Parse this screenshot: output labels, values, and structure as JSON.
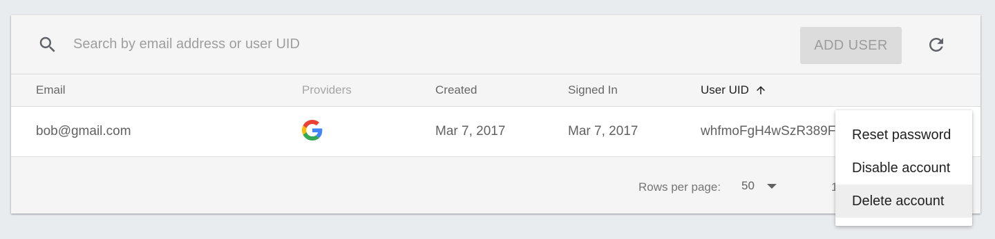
{
  "toolbar": {
    "search_placeholder": "Search by email address or user UID",
    "search_value": "",
    "add_user_label": "ADD USER"
  },
  "table": {
    "columns": [
      "Email",
      "Providers",
      "Created",
      "Signed In",
      "User UID"
    ],
    "sorted_column": "User UID",
    "sort_direction": "ascending",
    "rows": [
      {
        "email": "bob@gmail.com",
        "provider_icon": "google-icon",
        "created": "Mar 7, 2017",
        "signed_in": "Mar 7, 2017",
        "uid": "whfmoFgH4wSzR389F"
      }
    ]
  },
  "pagination": {
    "rows_per_page_label": "Rows per page:",
    "rows_per_page_value": "50",
    "page_range_partial": "1"
  },
  "context_menu": {
    "items": [
      "Reset password",
      "Disable account",
      "Delete account"
    ],
    "highlighted": "Delete account"
  },
  "colors": {
    "page_background": "#e9ecef",
    "card_background": "#f5f5f5",
    "row_background": "#ffffff",
    "button_disabled": "#dcdcdc",
    "google_blue": "#4285F4",
    "google_red": "#EA4335",
    "google_yellow": "#FBBC05",
    "google_green": "#34A853"
  }
}
